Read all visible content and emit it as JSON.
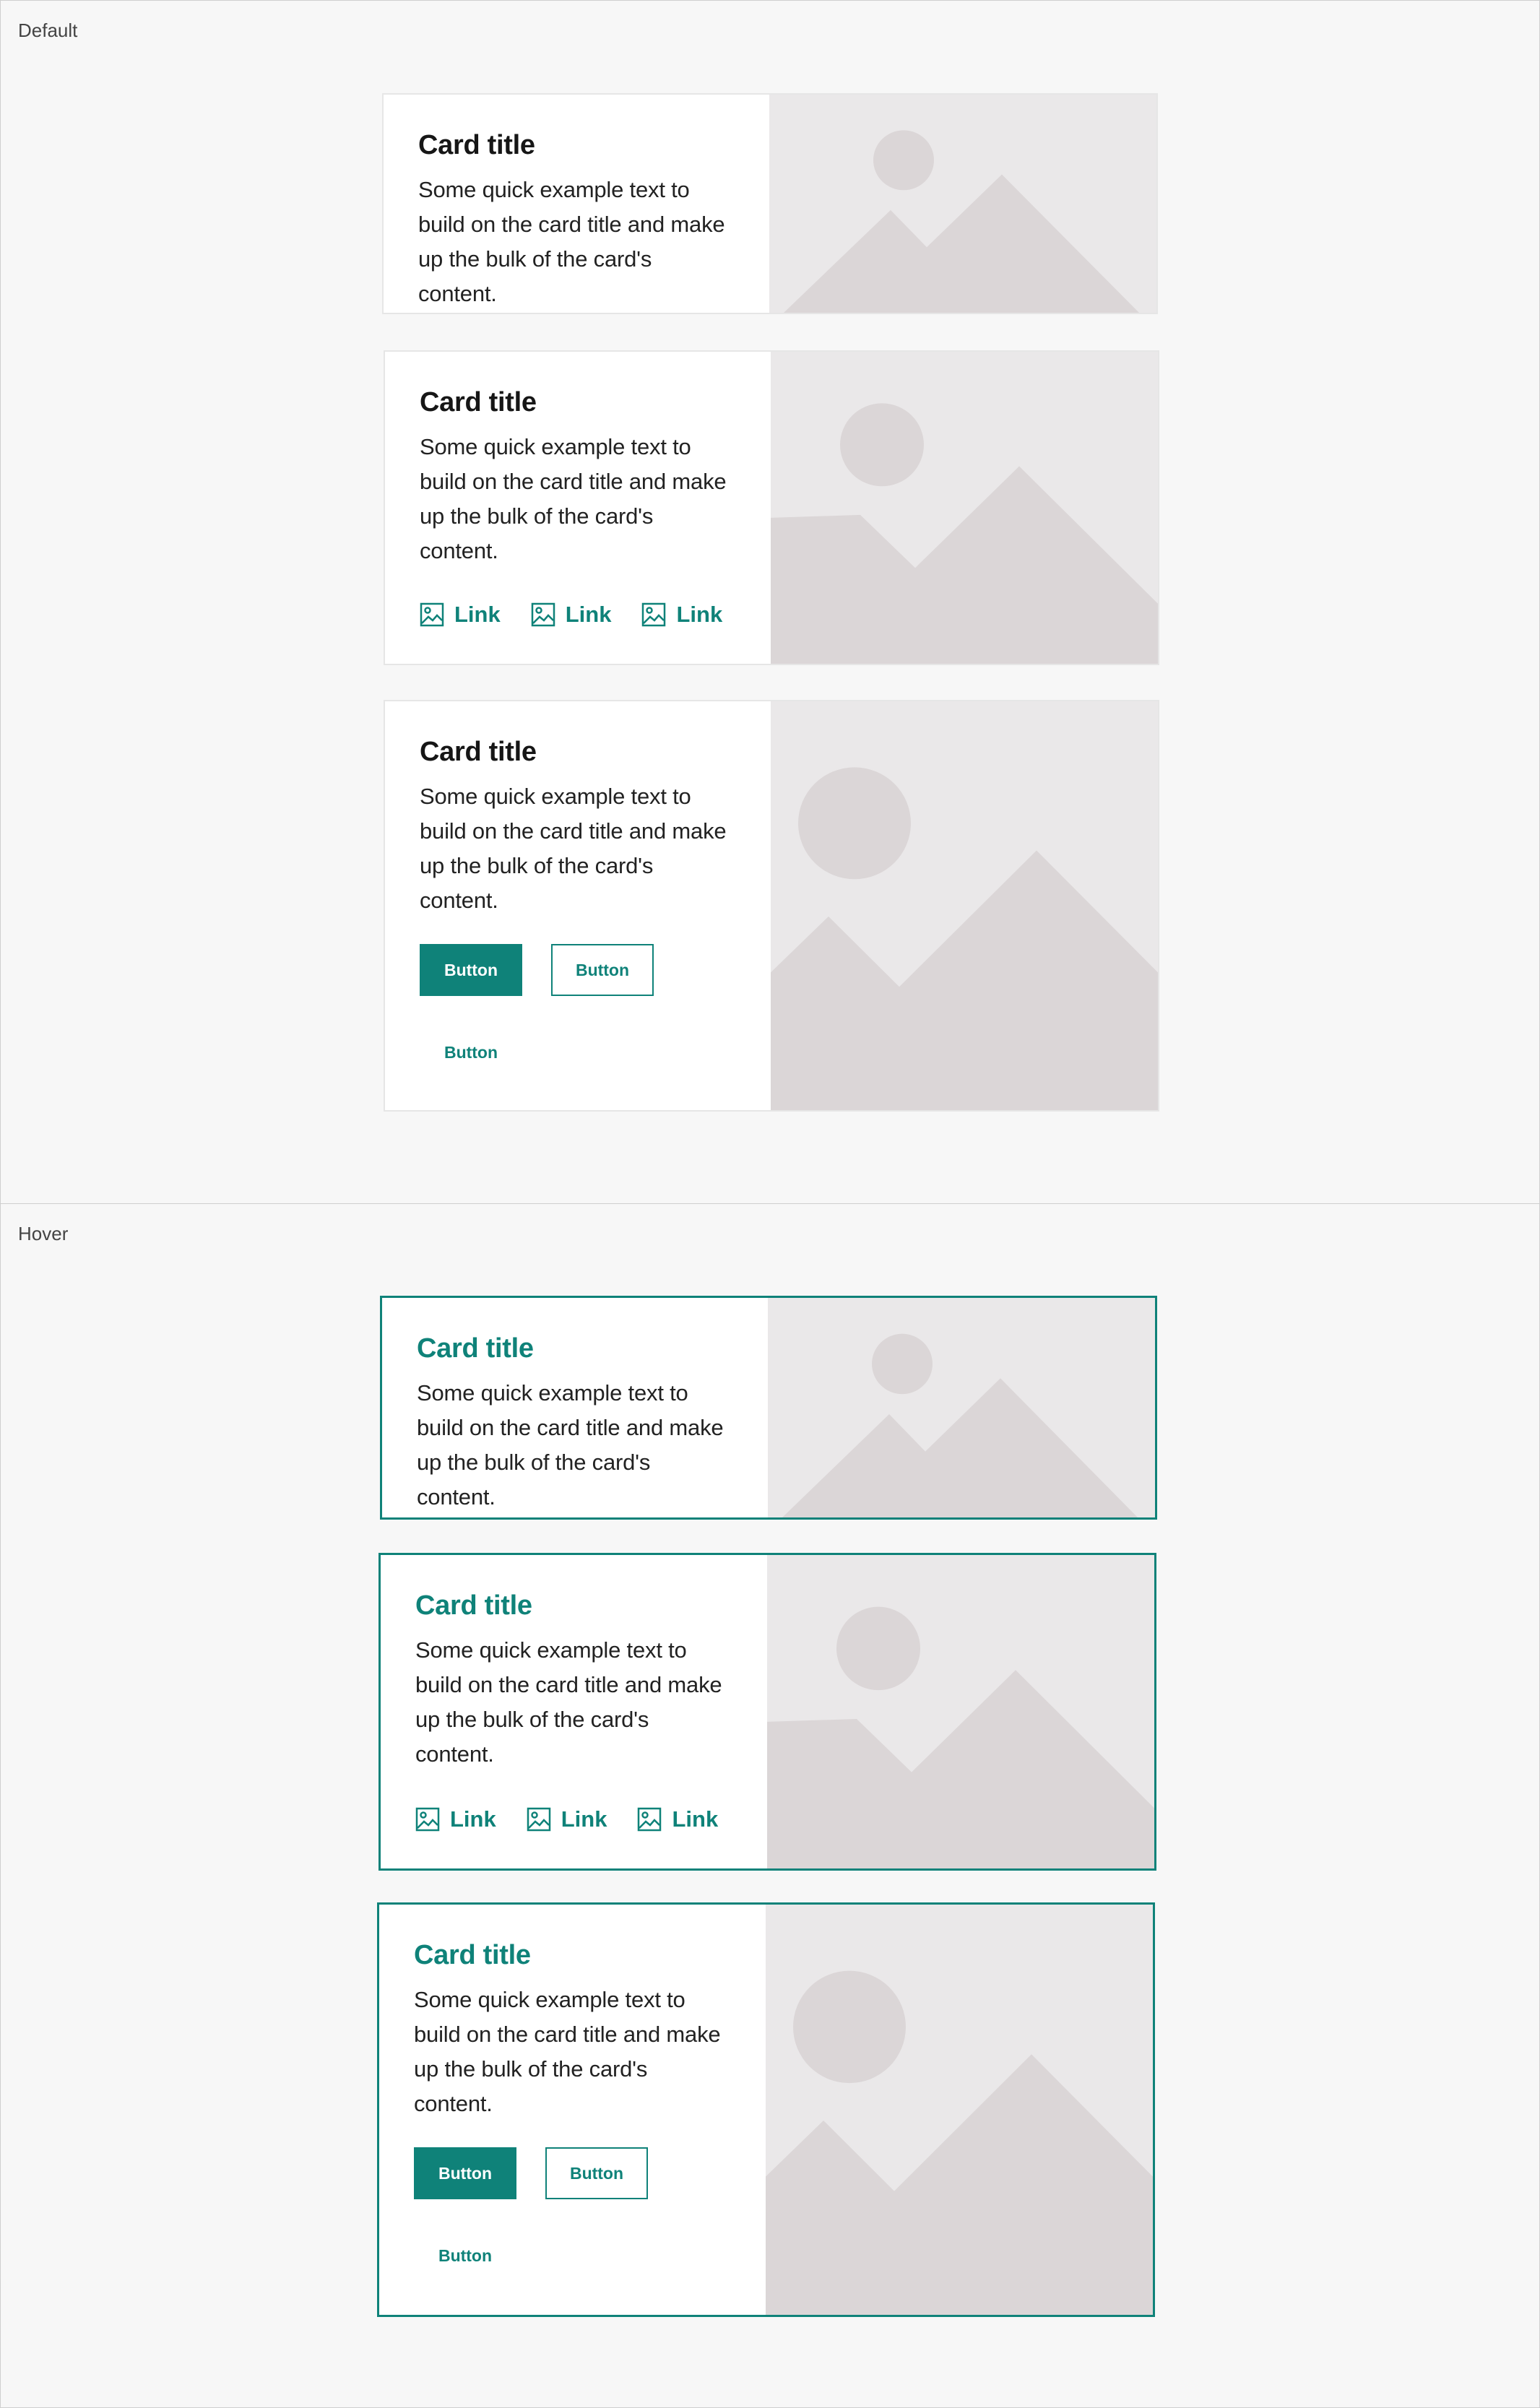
{
  "sections": {
    "default": {
      "label": "Default"
    },
    "hover": {
      "label": "Hover"
    }
  },
  "card": {
    "title": "Card title",
    "text": "Some quick example text to build on the card title and make up the bulk of the card's content.",
    "link_label": "Link",
    "button_primary": "Button",
    "button_outline": "Button",
    "button_text": "Button"
  },
  "colors": {
    "accent": "#0f8279",
    "placeholder_bg": "#eae8e9",
    "placeholder_shape": "#dbd6d7"
  }
}
